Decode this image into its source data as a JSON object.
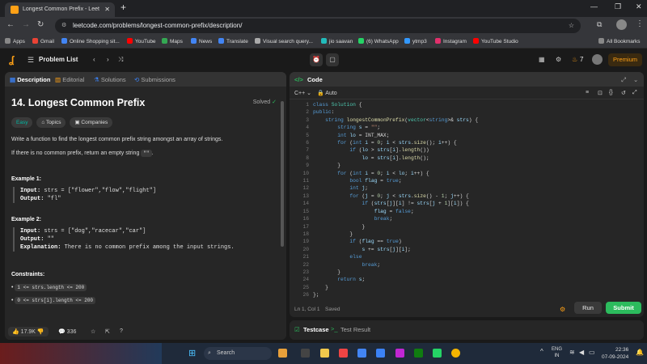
{
  "browser": {
    "tab_title": "Longest Common Prefix - Leet",
    "url": "leetcode.com/problems/longest-common-prefix/description/",
    "bookmarks": [
      "Apps",
      "Gmail",
      "Online Shopping sit...",
      "YouTube",
      "Maps",
      "News",
      "Translate",
      "Visual search query...",
      "jio saavan",
      "(6) WhatsApp",
      "ytmp3",
      "Instagram",
      "YouTube Studio"
    ],
    "all_bookmarks": "All Bookmarks"
  },
  "nav": {
    "problem_list": "Problem List",
    "streak": "7",
    "premium": "Premium"
  },
  "left_tabs": [
    "Description",
    "Editorial",
    "Solutions",
    "Submissions"
  ],
  "problem": {
    "title": "14. Longest Common Prefix",
    "status": "Solved",
    "difficulty": "Easy",
    "topics": "Topics",
    "companies": "Companies",
    "statement": "Write a function to find the longest common prefix string amongst an array of strings.",
    "statement2_pre": "If there is no common prefix, return an empty string",
    "statement2_code": "\"\"",
    "ex1_title": "Example 1:",
    "ex1_input_label": "Input:",
    "ex1_input": "strs = [\"flower\",\"flow\",\"flight\"]",
    "ex1_output_label": "Output:",
    "ex1_output": "\"fl\"",
    "ex2_title": "Example 2:",
    "ex2_input_label": "Input:",
    "ex2_input": "strs = [\"dog\",\"racecar\",\"car\"]",
    "ex2_output_label": "Output:",
    "ex2_output": "\"\"",
    "ex2_expl_label": "Explanation:",
    "ex2_expl": "There is no common prefix among the input strings.",
    "constraints_title": "Constraints:",
    "c1": "1 <= strs.length <= 200",
    "c2": "0 <= strs[i].length <= 200",
    "likes": "17.9K",
    "comments": "336"
  },
  "editor": {
    "title": "Code",
    "language": "C++",
    "mode": "Auto",
    "position": "Ln 1, Col 1",
    "saved": "Saved",
    "run": "Run",
    "submit": "Submit",
    "line_numbers": [
      "1",
      "2",
      "3",
      "4",
      "5",
      "6",
      "7",
      "8",
      "9",
      "10",
      "11",
      "12",
      "13",
      "14",
      "15",
      "16",
      "17",
      "18",
      "19",
      "20",
      "21",
      "22",
      "23",
      "24",
      "25",
      "26"
    ]
  },
  "bottom_tabs": {
    "testcase": "Testcase",
    "result": "Test Result"
  },
  "taskbar": {
    "search": "Search",
    "lang": "ENG",
    "region": "IN",
    "time": "22:36",
    "date": "07-09-2024"
  },
  "colors": {
    "accent": "#ffa116",
    "green": "#2cbb5d",
    "easy": "#00b8a3"
  }
}
